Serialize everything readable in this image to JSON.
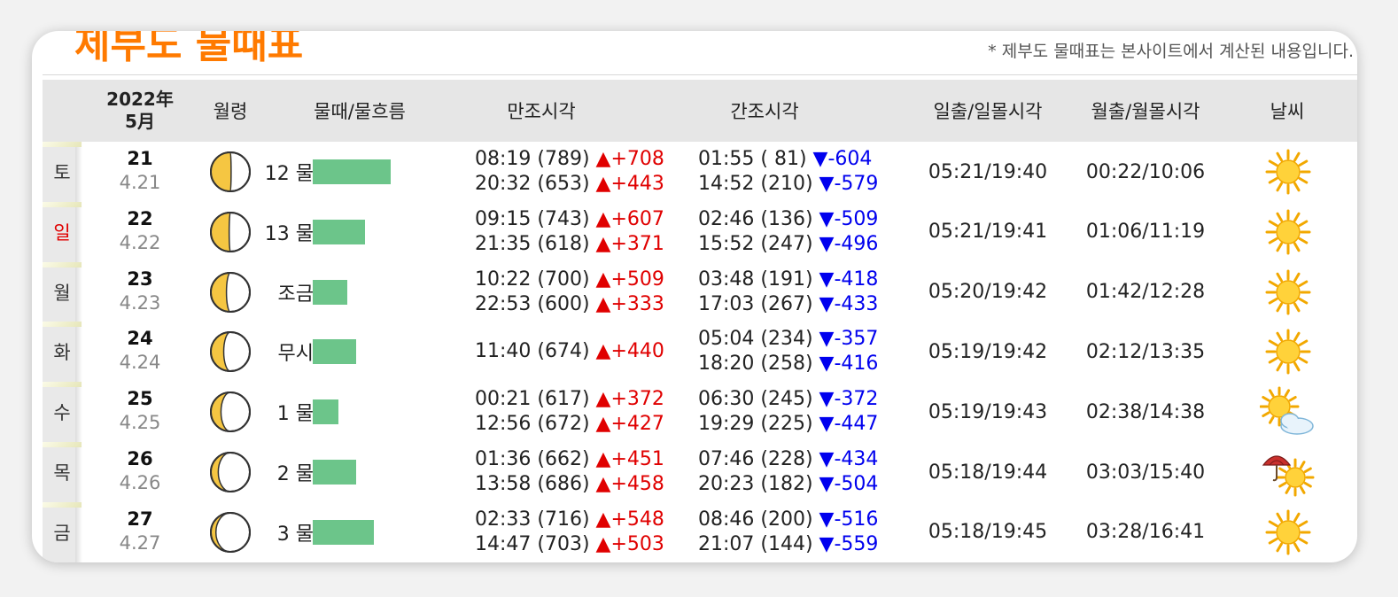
{
  "page": {
    "title": "제부도 물때표",
    "notice": "* 제부도 물때표는 본사이트에서 계산된 내용입니다."
  },
  "header": {
    "year": "2022年",
    "month": "5月",
    "moon_age": "월령",
    "tide": "물때/물흐름",
    "high": "만조시각",
    "low": "간조시각",
    "sun": "일출/일몰시각",
    "moon": "월출/월몰시각",
    "weather": "날씨"
  },
  "colors": {
    "accent": "#ff7a00",
    "rise": "#e00000",
    "fall": "#0000ee",
    "bar": "#6cc58a",
    "sunday": "#e00000"
  },
  "rows": [
    {
      "dow": "토",
      "day": "21",
      "lunar": "4.21",
      "tide": "12 물",
      "flow_level": 0.88,
      "lit_fraction": 0.52,
      "high": [
        "08:19 (789) ",
        "▲+708",
        "20:32 (653) ",
        "▲+443"
      ],
      "low": [
        "01:55 ( 81) ",
        "▼-604",
        "14:52 (210) ",
        "▼-579"
      ],
      "sun": "05:21/19:40",
      "moon": "00:22/10:06",
      "weather": "sunny-icon"
    },
    {
      "dow": "일",
      "day": "22",
      "lunar": "4.22",
      "tide": "13 물",
      "flow_level": 0.59,
      "lit_fraction": 0.47,
      "holiday": true,
      "high": [
        "09:15 (743) ",
        "▲+607",
        "21:35 (618) ",
        "▲+371"
      ],
      "low": [
        "02:46 (136) ",
        "▼-509",
        "15:52 (247) ",
        "▼-496"
      ],
      "sun": "05:21/19:41",
      "moon": "01:06/11:19",
      "weather": "sunny-icon"
    },
    {
      "dow": "월",
      "day": "23",
      "lunar": "4.23",
      "tide": "조금",
      "flow_level": 0.39,
      "lit_fraction": 0.4,
      "high": [
        "10:22 (700) ",
        "▲+509",
        "22:53 (600) ",
        "▲+333"
      ],
      "low": [
        "03:48 (191) ",
        "▼-418",
        "17:03 (267) ",
        "▼-433"
      ],
      "sun": "05:20/19:42",
      "moon": "01:42/12:28",
      "weather": "sunny-icon"
    },
    {
      "dow": "화",
      "day": "24",
      "lunar": "4.24",
      "tide": "무시",
      "flow_level": 0.49,
      "lit_fraction": 0.33,
      "high": [
        "11:40 (674) ",
        "▲+440"
      ],
      "low": [
        "05:04 (234) ",
        "▼-357",
        "18:20 (258) ",
        "▼-416"
      ],
      "sun": "05:19/19:42",
      "moon": "02:12/13:35",
      "weather": "sunny-icon"
    },
    {
      "dow": "수",
      "day": "25",
      "lunar": "4.25",
      "tide": "1 물",
      "flow_level": 0.29,
      "lit_fraction": 0.26,
      "high": [
        "00:21 (617) ",
        "▲+372",
        "12:56 (672) ",
        "▲+427"
      ],
      "low": [
        "06:30 (245) ",
        "▼-372",
        "19:29 (225) ",
        "▼-447"
      ],
      "sun": "05:19/19:43",
      "moon": "02:38/14:38",
      "weather": "sun-cloud-icon"
    },
    {
      "dow": "목",
      "day": "26",
      "lunar": "4.26",
      "tide": "2 물",
      "flow_level": 0.49,
      "lit_fraction": 0.19,
      "high": [
        "01:36 (662) ",
        "▲+451",
        "13:58 (686) ",
        "▲+458"
      ],
      "low": [
        "07:46 (228) ",
        "▼-434",
        "20:23 (182) ",
        "▼-504"
      ],
      "sun": "05:18/19:44",
      "moon": "03:03/15:40",
      "weather": "umbrella-sun-icon"
    },
    {
      "dow": "금",
      "day": "27",
      "lunar": "4.27",
      "tide": "3 물",
      "flow_level": 0.69,
      "lit_fraction": 0.13,
      "high": [
        "02:33 (716) ",
        "▲+548",
        "14:47 (703) ",
        "▲+503"
      ],
      "low": [
        "08:46 (200) ",
        "▼-516",
        "21:07 (144) ",
        "▼-559"
      ],
      "sun": "05:18/19:45",
      "moon": "03:28/16:41",
      "weather": "sunny-icon"
    }
  ]
}
